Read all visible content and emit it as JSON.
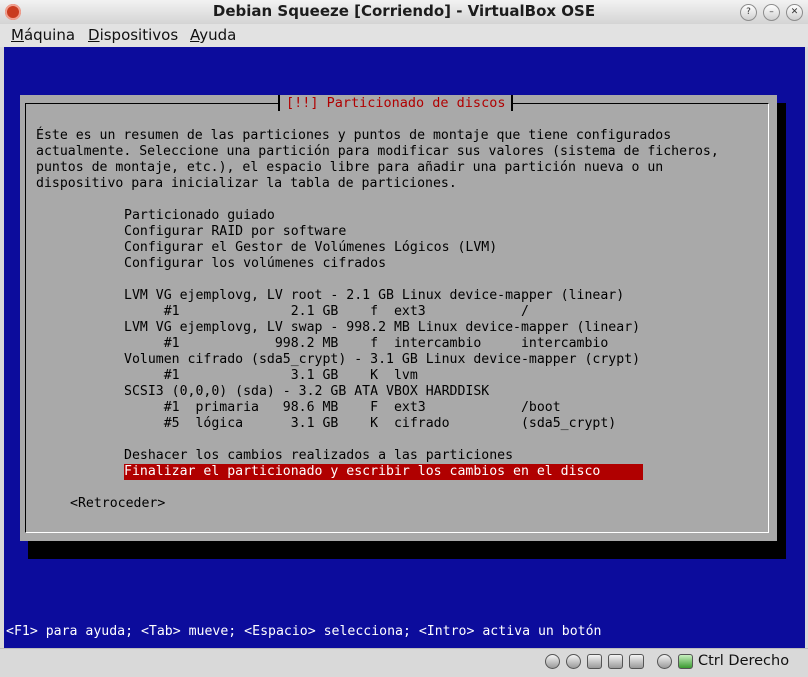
{
  "window": {
    "title": "Debian Squeeze [Corriendo] - VirtualBox OSE",
    "buttons": [
      "?",
      "–",
      "✕"
    ]
  },
  "menubar": {
    "items": [
      {
        "label": "Máquina",
        "underline": "M"
      },
      {
        "label": "Dispositivos",
        "underline": "D"
      },
      {
        "label": "Ayuda",
        "underline": "A"
      }
    ]
  },
  "dialog": {
    "title": "[!!] Particionado de discos",
    "intro": [
      "Éste es un resumen de las particiones y puntos de montaje que tiene configurados",
      "actualmente. Seleccione una partición para modificar sus valores (sistema de ficheros,",
      "puntos de montaje, etc.), el espacio libre para añadir una partición nueva o un",
      "dispositivo para inicializar la tabla de particiones."
    ],
    "options": [
      "Particionado guiado",
      "Configurar RAID por software",
      "Configurar el Gestor de Volúmenes Lógicos (LVM)",
      "Configurar los volúmenes cifrados"
    ],
    "partitions": [
      "LVM VG ejemplovg, LV root - 2.1 GB Linux device-mapper (linear)",
      "     #1              2.1 GB    f  ext3            /",
      "LVM VG ejemplovg, LV swap - 998.2 MB Linux device-mapper (linear)",
      "     #1            998.2 MB    f  intercambio     intercambio",
      "Volumen cifrado (sda5_crypt) - 3.1 GB Linux device-mapper (crypt)",
      "     #1              3.1 GB    K  lvm",
      "SCSI3 (0,0,0) (sda) - 3.2 GB ATA VBOX HARDDISK",
      "     #1  primaria   98.6 MB    F  ext3            /boot",
      "     #5  lógica      3.1 GB    K  cifrado         (sda5_crypt)"
    ],
    "undo": "Deshacer los cambios realizados a las particiones",
    "finish": "Finalizar el particionado y escribir los cambios en el disco",
    "back": "<Retroceder>"
  },
  "helpline": "<F1> para ayuda; <Tab> mueve; <Espacio> selecciona; <Intro> activa un botón",
  "statusbar": {
    "hostkey": "Ctrl Derecho",
    "icons": [
      "hard-disk-icon",
      "cd-icon",
      "network-icon",
      "usb-icon",
      "shared-folder-icon",
      "virtualization-icon",
      "mouse-integration-icon"
    ]
  }
}
